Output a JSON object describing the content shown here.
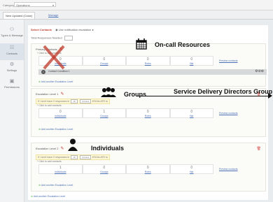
{
  "topbar": {
    "category_label": "Category",
    "category_value": "Operations"
  },
  "tabs": {
    "active": "New Updated (Close)",
    "link": "Manage"
  },
  "sidebar": {
    "items": [
      {
        "label": "Types & Message",
        "icon": "users-icon"
      },
      {
        "label": "Contacts",
        "icon": "contacts-icon"
      },
      {
        "label": "Settings",
        "icon": "gear-icon"
      },
      {
        "label": "Permissions",
        "icon": "lock-icon"
      }
    ]
  },
  "header": {
    "title": "Select Contacts",
    "option": "Use notification escalation",
    "trn_label": "Total Responses Needed"
  },
  "level1": {
    "title": "Primary Contacts",
    "click_text": "* Click to add contacts",
    "stats": [
      {
        "n": "0",
        "l": "Individuals"
      },
      {
        "n": "0",
        "l": "Groups"
      },
      {
        "n": "0",
        "l": "Roles"
      },
      {
        "n": "0",
        "l": "Ilist"
      }
    ],
    "preview": "Preview contacts",
    "bar_text": "Contact Condition 1",
    "add": "Add another Escalation Level"
  },
  "level2": {
    "title": "Escalation Level 1",
    "notify_pre": "If I don't have X responses in",
    "notify_num": "15",
    "notify_unit": "minutes",
    "notify_post": "ESCALATE to",
    "click_text": "* Click to add contacts",
    "stats": [
      {
        "n": "0",
        "l": "Individuals"
      },
      {
        "n": "1",
        "l": "Groups"
      },
      {
        "n": "0",
        "l": "Roles"
      },
      {
        "n": "0",
        "l": "Ilist"
      }
    ],
    "preview": "Preview contacts",
    "add": "Add another Escalation Level"
  },
  "level3": {
    "title": "Escalation Level 2",
    "notify_pre": "If I don't have X responses in",
    "notify_num": "15",
    "notify_unit": "minutes",
    "notify_post": "ESCALATE to",
    "click_text": "* Click to add contacts",
    "stats": [
      {
        "n": "1",
        "l": "Individuals"
      },
      {
        "n": "0",
        "l": "Groups"
      },
      {
        "n": "0",
        "l": "Roles"
      },
      {
        "n": "0",
        "l": "Ilist"
      }
    ],
    "preview": "Preview contacts",
    "add": "Add another Escalation Level"
  },
  "bottom_link": "Add another Escalation Level",
  "annotations": {
    "oncall": "On-call Resources",
    "groups": "Groups",
    "sdd": "Service Delivery Directors Group",
    "individuals": "Individuals"
  }
}
